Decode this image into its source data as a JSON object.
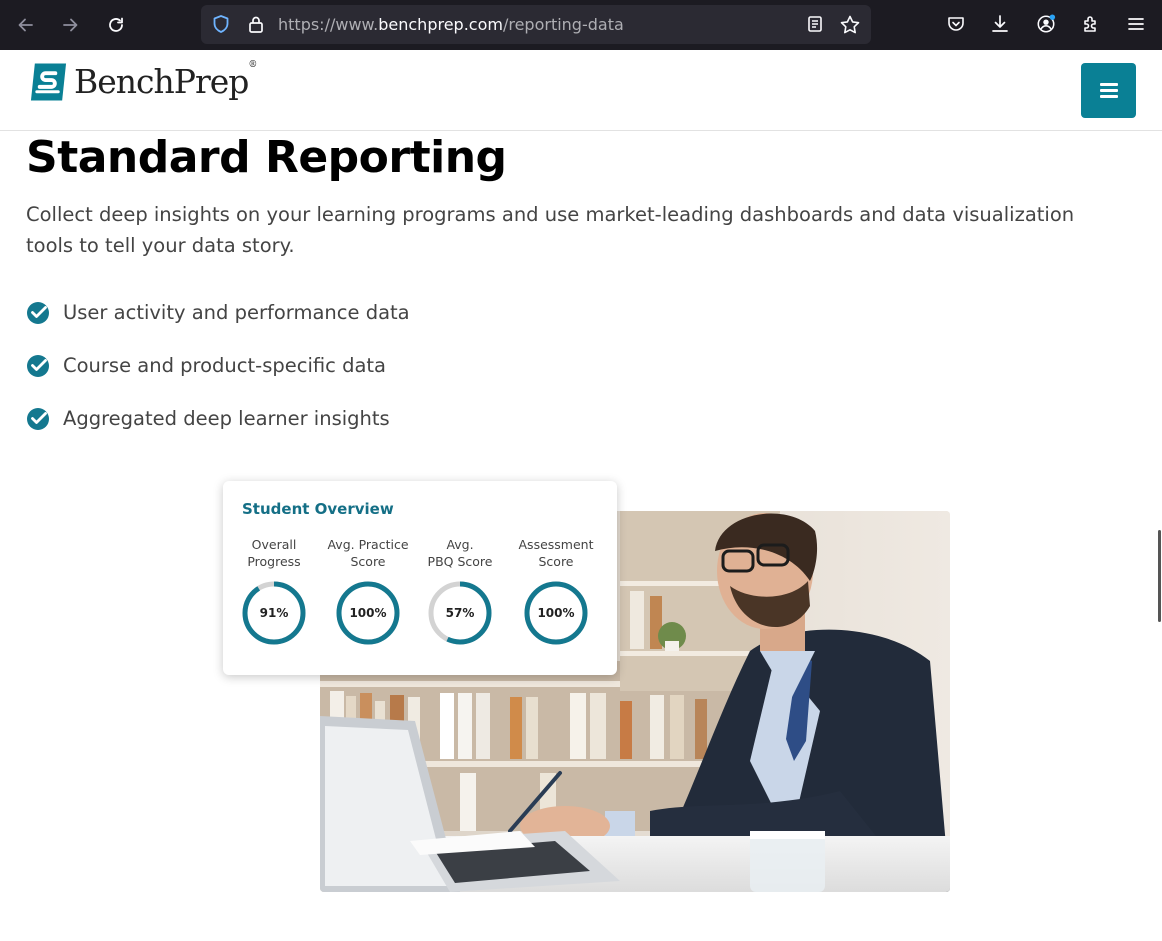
{
  "browser": {
    "url_prefix": "https://www.",
    "url_domain": "benchprep.com",
    "url_path": "/reporting-data"
  },
  "header": {
    "logo_text": "BenchPrep",
    "logo_reg": "®"
  },
  "main": {
    "title": "Standard Reporting",
    "intro": "Collect deep insights on your learning programs and use market-leading dashboards and data visualization tools to tell your data story.",
    "features": [
      "User activity and performance data",
      "Course and product-specific data",
      "Aggregated deep learner insights"
    ]
  },
  "overview_card": {
    "title": "Student Overview",
    "metrics": [
      {
        "label": "Overall\nProgress",
        "value": "91%",
        "fraction": 0.91
      },
      {
        "label": "Avg. Practice\nScore",
        "value": "100%",
        "fraction": 1.0
      },
      {
        "label": "Avg.\nPBQ Score",
        "value": "57%",
        "fraction": 0.57
      },
      {
        "label": "Assessment\nScore",
        "value": "100%",
        "fraction": 1.0
      }
    ]
  },
  "colors": {
    "accent": "#0a8095",
    "gauge_fill": "#14788f",
    "gauge_track": "#d3d3d3",
    "card_title": "#146f86",
    "chrome_bg": "#1c1b22"
  }
}
